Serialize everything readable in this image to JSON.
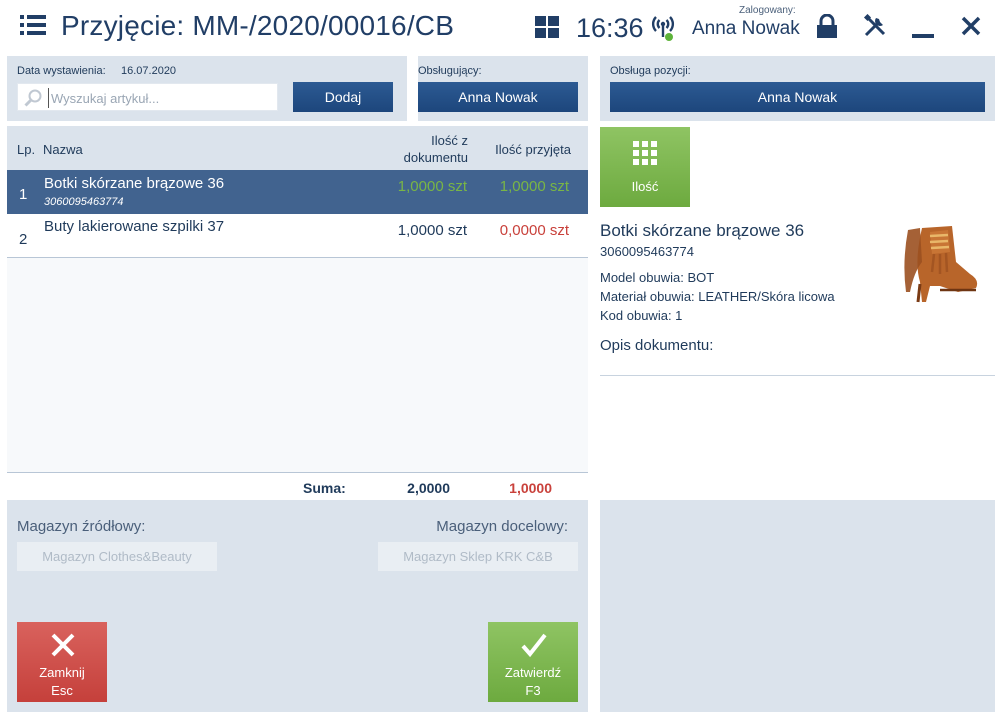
{
  "header": {
    "title": "Przyjęcie: MM-/2020/00016/CB",
    "time": "16:36",
    "logged_label": "Zalogowany:",
    "user": "Anna Nowak"
  },
  "document": {
    "date_label": "Data wystawienia:",
    "date_value": "16.07.2020",
    "search_placeholder": "Wyszukaj artykuł...",
    "add_label": "Dodaj",
    "handler_label": "Obsługujący:",
    "handler_value": "Anna Nowak",
    "position_handler_label": "Obsługa pozycji:",
    "position_handler_value": "Anna Nowak"
  },
  "table": {
    "headers": {
      "lp": "Lp.",
      "name": "Nazwa",
      "qty_doc": "Ilość z dokumentu",
      "qty_received": "Ilość przyjęta"
    },
    "rows": [
      {
        "lp": "1",
        "name": "Botki skórzane brązowe 36",
        "code": "3060095463774",
        "qty_doc": "1,0000 szt",
        "qty_received": "1,0000 szt"
      },
      {
        "lp": "2",
        "name": "Buty lakierowane szpilki 37",
        "code": "",
        "qty_doc": "1,0000 szt",
        "qty_received": "0,0000 szt"
      }
    ],
    "sum_label": "Suma:",
    "sum_qty_doc": "2,0000",
    "sum_qty_received": "1,0000"
  },
  "warehouses": {
    "source_label": "Magazyn źródłowy:",
    "source_value": "Magazyn Clothes&Beauty",
    "target_label": "Magazyn docelowy:",
    "target_value": "Magazyn Sklep KRK C&B"
  },
  "actions": {
    "close_label": "Zamknij",
    "close_key": "Esc",
    "confirm_label": "Zatwierdź",
    "confirm_key": "F3",
    "quantity_label": "Ilość"
  },
  "details": {
    "name": "Botki skórzane brązowe 36",
    "code": "3060095463774",
    "attr_model": "Model obuwia: BOT",
    "attr_material": "Materiał obuwia: LEATHER/Skóra licowa",
    "attr_code": "Kod obuwia: 1",
    "doc_description": "Opis dokumentu:"
  },
  "colors": {
    "navy": "#213e66",
    "selected_row": "#41638f",
    "panel_bg": "#dbe3ec",
    "green": "#79b546",
    "red": "#c9413b"
  }
}
